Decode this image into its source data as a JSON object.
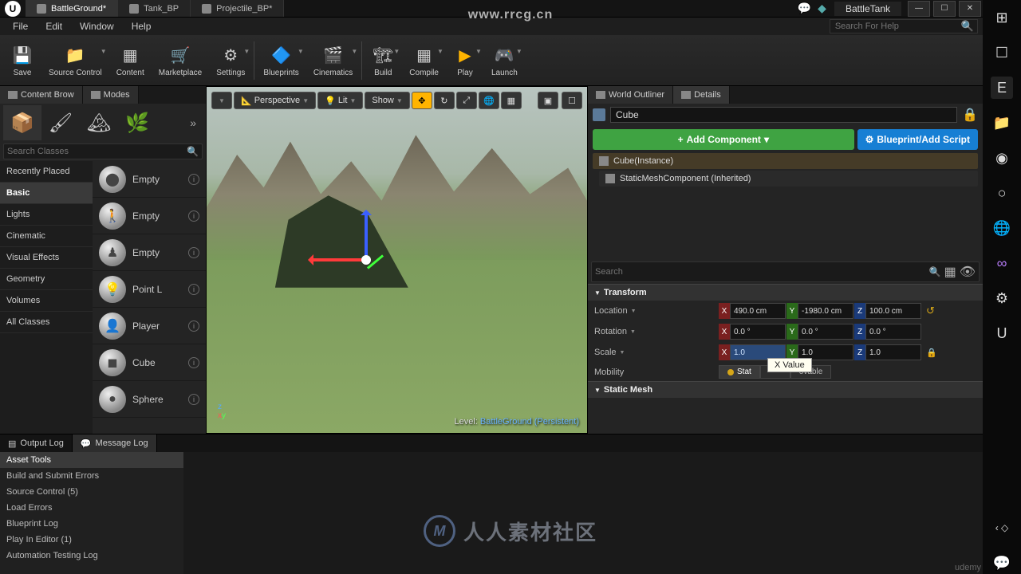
{
  "watermark_top": "www.rrcg.cn",
  "watermark_bottom": "udemy",
  "watermark_center": "人人素材社区",
  "title_bar": {
    "tabs": [
      {
        "label": "BattleGround*",
        "active": true
      },
      {
        "label": "Tank_BP"
      },
      {
        "label": "Projectile_BP*"
      }
    ],
    "app_name": "BattleTank"
  },
  "menu": {
    "items": [
      "File",
      "Edit",
      "Window",
      "Help"
    ],
    "search_placeholder": "Search For Help"
  },
  "toolbar": [
    {
      "label": "Save",
      "icon": "💾",
      "kind": "save"
    },
    {
      "label": "Source Control",
      "icon": "📁",
      "kind": "source",
      "drop": true
    },
    {
      "label": "Content",
      "icon": "▦",
      "kind": "content"
    },
    {
      "label": "Marketplace",
      "icon": "🛒",
      "kind": "market"
    },
    {
      "label": "Settings",
      "icon": "⚙",
      "kind": "settings",
      "drop": true
    },
    {
      "sep": true
    },
    {
      "label": "Blueprints",
      "icon": "🔷",
      "kind": "bp",
      "drop": true
    },
    {
      "label": "Cinematics",
      "icon": "🎬",
      "kind": "cine",
      "drop": true
    },
    {
      "sep": true
    },
    {
      "label": "Build",
      "icon": "🏗",
      "kind": "build",
      "drop": true
    },
    {
      "label": "Compile",
      "icon": "▦",
      "kind": "compile",
      "drop": true
    },
    {
      "label": "Play",
      "icon": "▶",
      "kind": "play",
      "drop": true
    },
    {
      "label": "Launch",
      "icon": "🎮",
      "kind": "launch",
      "drop": true
    }
  ],
  "modes_panel": {
    "tabs": [
      {
        "label": "Content Brow"
      },
      {
        "label": "Modes"
      }
    ],
    "search_placeholder": "Search Classes",
    "categories": [
      "Recently Placed",
      "Basic",
      "Lights",
      "Cinematic",
      "Visual Effects",
      "Geometry",
      "Volumes",
      "All Classes"
    ],
    "selected_category": "Basic",
    "actors": [
      {
        "label": "Empty",
        "icon": "⬤"
      },
      {
        "label": "Empty",
        "icon": "🚶"
      },
      {
        "label": "Empty",
        "icon": "♟"
      },
      {
        "label": "Point L",
        "icon": "💡"
      },
      {
        "label": "Player",
        "icon": "👤"
      },
      {
        "label": "Cube",
        "icon": "◼"
      },
      {
        "label": "Sphere",
        "icon": "●"
      }
    ]
  },
  "viewport": {
    "buttons": {
      "perspective": "Perspective",
      "lit": "Lit",
      "show": "Show"
    },
    "level_prefix": "Level:",
    "level_name": "BattleGround (Persistent)"
  },
  "outliner": {
    "tabs": [
      {
        "label": "World Outliner"
      },
      {
        "label": "Details",
        "active": true
      }
    ]
  },
  "details": {
    "object_name": "Cube",
    "add_component": "Add Component",
    "blueprint_btn": "Blueprint/Add Script",
    "root_component": "Cube(Instance)",
    "child_component": "StaticMeshComponent (Inherited)",
    "search_placeholder": "Search",
    "sections": {
      "transform": "Transform",
      "static_mesh": "Static Mesh"
    },
    "transform": {
      "location": {
        "label": "Location",
        "x": "490.0 cm",
        "y": "-1980.0 cm",
        "z": "100.0 cm"
      },
      "rotation": {
        "label": "Rotation",
        "x": "0.0 °",
        "y": "0.0 °",
        "z": "0.0 °"
      },
      "scale": {
        "label": "Scale",
        "x": "1.0",
        "y": "1.0",
        "z": "1.0"
      },
      "mobility": {
        "label": "Mobility",
        "options": [
          "Stat",
          "",
          "ovable"
        ],
        "selected": 0
      }
    },
    "tooltip": "X Value"
  },
  "bottom_panel": {
    "tabs": [
      {
        "label": "Output Log"
      },
      {
        "label": "Message Log",
        "active": true
      }
    ],
    "categories": [
      "Asset Tools",
      "Build and Submit Errors",
      "Source Control (5)",
      "Load Errors",
      "Blueprint Log",
      "Play In Editor (1)",
      "Automation Testing Log"
    ]
  }
}
